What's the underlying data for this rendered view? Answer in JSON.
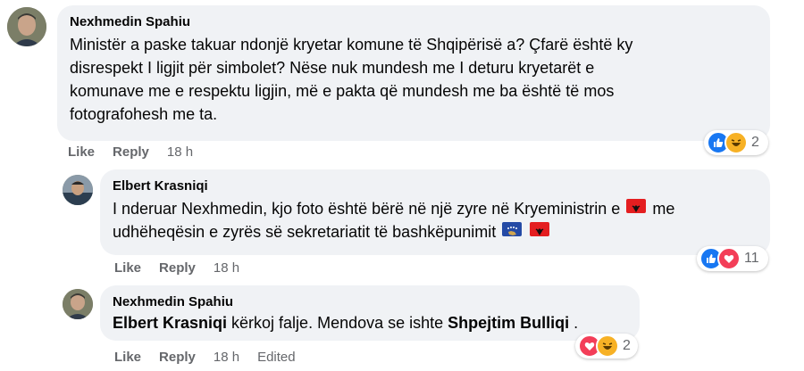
{
  "comments": [
    {
      "author": "Nexhmedin Spahiu",
      "lines": [
        "Ministër a paske takuar ndonjë kryetar komune të Shqipërisë a? Çfarë është ky",
        "disrespekt I ligjit për simbolet? Nëse nuk mundesh me I deturu kryetarët e",
        "komunave me e respektu ligjin, më e pakta që mundesh me ba është të mos",
        "fotografohesh me ta."
      ],
      "like_label": "Like",
      "reply_label": "Reply",
      "time": "18 h",
      "reaction_count": "2",
      "reactions": [
        "like-icon",
        "haha-icon"
      ]
    },
    {
      "author": "Elbert Krasniqi",
      "line1": "I nderuar Nexhmedin, kjo foto është bërë në një zyre në Kryeministrin e",
      "line1_end": "me",
      "line2": "udhëheqësin e zyrës së sekretariatit të bashkëpunimit",
      "like_label": "Like",
      "reply_label": "Reply",
      "time": "18 h",
      "reaction_count": "11",
      "reactions": [
        "like-icon",
        "love-icon"
      ]
    },
    {
      "author": "Nexhmedin Spahiu",
      "mention1": "Elbert Krasniqi",
      "middle": " kërkoj falje. Mendova se ishte ",
      "mention2": "Shpejtim Bulliqi",
      "end": " .",
      "like_label": "Like",
      "reply_label": "Reply",
      "time": "18 h",
      "edited_label": "Edited",
      "reaction_count": "2",
      "reactions": [
        "love-icon",
        "haha-icon"
      ]
    }
  ],
  "colors": {
    "bubble": "#f0f2f5",
    "meta": "#65676b",
    "like_blue": "#1877f2",
    "love_red": "#f33e58",
    "haha_yellow": "#f7b125"
  }
}
